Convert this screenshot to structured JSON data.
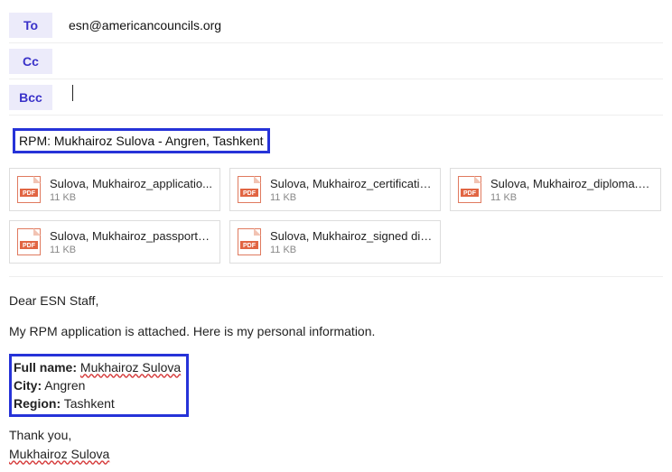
{
  "header": {
    "to_label": "To",
    "to_value": "esn@americancouncils.org",
    "cc_label": "Cc",
    "cc_value": "",
    "bcc_label": "Bcc",
    "bcc_value": ""
  },
  "subject": "RPM: Mukhairoz Sulova - Angren, Tashkent",
  "attachments": [
    {
      "name": "Sulova, Mukhairoz_applicatio...",
      "size": "11 KB"
    },
    {
      "name": "Sulova, Mukhairoz_certificatio...",
      "size": "11 KB"
    },
    {
      "name": "Sulova, Mukhairoz_diploma.pdf",
      "size": "11 KB"
    },
    {
      "name": "Sulova, Mukhairoz_passport.p...",
      "size": "11 KB"
    },
    {
      "name": "Sulova, Mukhairoz_signed dis...",
      "size": "11 KB"
    }
  ],
  "body": {
    "greeting": "Dear ESN Staff,",
    "intro": "My RPM application is attached. Here is my personal information.",
    "fullname_label": "Full name:",
    "fullname_value": "Mukhairoz Sulova",
    "city_label": "City:",
    "city_value": "Angren",
    "region_label": "Region:",
    "region_value": "Tashkent",
    "thanks": "Thank you,",
    "signature": "Mukhairoz Sulova"
  }
}
